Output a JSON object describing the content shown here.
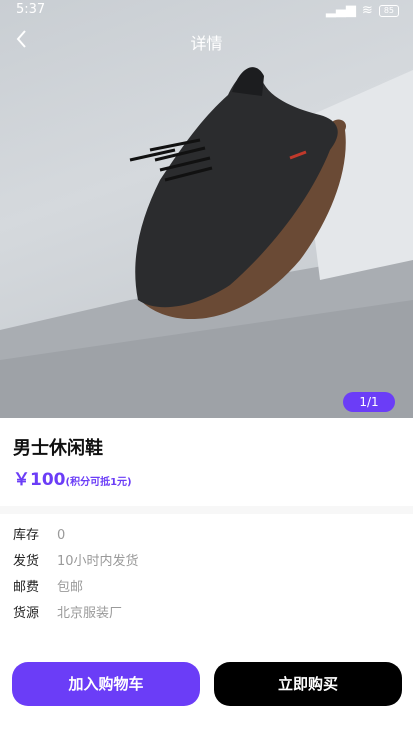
{
  "status_bar": {
    "time": "5:37",
    "battery": "85"
  },
  "header": {
    "title": "详情"
  },
  "gallery": {
    "counter": "1/1"
  },
  "product": {
    "name": "男士休闲鞋",
    "price": "￥100",
    "price_note": "(积分可抵1元)"
  },
  "details": [
    {
      "label": "库存",
      "value": "0"
    },
    {
      "label": "发货",
      "value": "10小时内发货"
    },
    {
      "label": "邮费",
      "value": "包邮"
    },
    {
      "label": "货源",
      "value": "北京服装厂"
    }
  ],
  "actions": {
    "add_to_cart": "加入购物车",
    "buy_now": "立即购买"
  },
  "colors": {
    "accent": "#6b3df7",
    "buy_button": "#000000"
  }
}
